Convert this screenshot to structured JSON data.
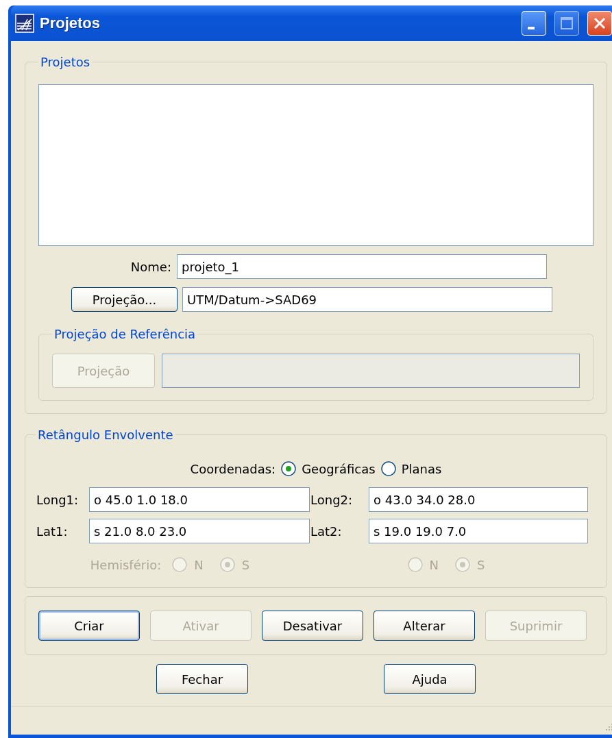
{
  "window": {
    "title": "Projetos"
  },
  "projects_group": {
    "title": "Projetos",
    "name": {
      "label": "Nome:",
      "value": "projeto_1"
    },
    "projection": {
      "button": "Projeção...",
      "value": "UTM/Datum->SAD69"
    },
    "reference": {
      "title": "Projeção de Referência",
      "button": {
        "label": "Projeção",
        "disabled": true
      },
      "field": {
        "disabled": true
      }
    }
  },
  "bounding_group": {
    "title": "Retângulo Envolvente",
    "coordinates": {
      "label": "Coordenadas:",
      "options": [
        {
          "label": "Geográficas",
          "selected": true
        },
        {
          "label": "Planas",
          "selected": false
        }
      ]
    },
    "fields": [
      {
        "label": "Long1:",
        "value": "o 45.0 1.0 18.0"
      },
      {
        "label": "Long2:",
        "value": "o 43.0 34.0 28.0"
      },
      {
        "label": "Lat1:",
        "value": "s 21.0 8.0 23.0"
      },
      {
        "label": "Lat2:",
        "value": "s 19.0 19.0 7.0"
      }
    ],
    "hemisphere": {
      "label": "Hemisfério:",
      "disabled": true,
      "columns": [
        {
          "options": [
            {
              "label": "N",
              "selected": false
            },
            {
              "label": "S",
              "selected": true
            }
          ]
        },
        {
          "options": [
            {
              "label": "N",
              "selected": false
            },
            {
              "label": "S",
              "selected": true
            }
          ]
        }
      ]
    }
  },
  "actions": [
    {
      "label": "Criar",
      "disabled": false,
      "focused": true
    },
    {
      "label": "Ativar",
      "disabled": true,
      "focused": false
    },
    {
      "label": "Desativar",
      "disabled": false,
      "focused": false
    },
    {
      "label": "Alterar",
      "disabled": false,
      "focused": false
    },
    {
      "label": "Suprimir",
      "disabled": true,
      "focused": false
    }
  ],
  "footer_buttons": [
    "Fechar",
    "Ajuda"
  ]
}
